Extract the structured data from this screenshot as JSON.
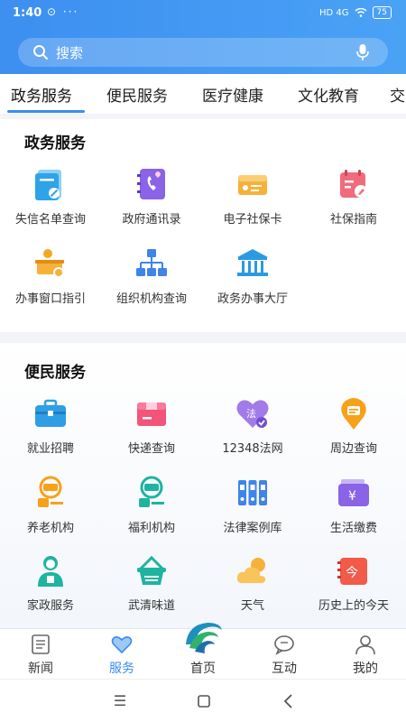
{
  "status": {
    "time": "1:40",
    "left_icons": "⊙ ···",
    "network": "HD 4G",
    "battery": "75"
  },
  "search": {
    "placeholder": "搜索"
  },
  "tabs": [
    "政务服务",
    "便民服务",
    "医疗健康",
    "文化教育",
    "交"
  ],
  "sections": [
    {
      "title": "政务服务",
      "items": [
        {
          "label": "失信名单查询",
          "icon": "document-list-icon"
        },
        {
          "label": "政府通讯录",
          "icon": "phone-book-icon"
        },
        {
          "label": "电子社保卡",
          "icon": "id-card-icon"
        },
        {
          "label": "社保指南",
          "icon": "calendar-edit-icon"
        },
        {
          "label": "办事窗口指引",
          "icon": "service-desk-icon"
        },
        {
          "label": "组织机构查询",
          "icon": "org-chart-icon"
        },
        {
          "label": "政务办事大厅",
          "icon": "government-hall-icon"
        }
      ]
    },
    {
      "title": "便民服务",
      "items": [
        {
          "label": "就业招聘",
          "icon": "briefcase-icon"
        },
        {
          "label": "快递查询",
          "icon": "package-icon"
        },
        {
          "label": "12348法网",
          "icon": "law-heart-icon"
        },
        {
          "label": "周边查询",
          "icon": "map-pin-icon"
        },
        {
          "label": "养老机构",
          "icon": "elderly-care-icon"
        },
        {
          "label": "福利机构",
          "icon": "welfare-icon"
        },
        {
          "label": "法律案例库",
          "icon": "binders-icon"
        },
        {
          "label": "生活缴费",
          "icon": "payment-icon"
        },
        {
          "label": "家政服务",
          "icon": "housekeeper-icon"
        },
        {
          "label": "武清味道",
          "icon": "food-basket-icon"
        },
        {
          "label": "天气",
          "icon": "weather-icon"
        },
        {
          "label": "历史上的今天",
          "icon": "today-calendar-icon"
        }
      ]
    }
  ],
  "bottom_nav": [
    {
      "label": "新闻",
      "icon": "news-icon"
    },
    {
      "label": "服务",
      "icon": "service-heart-icon",
      "active": true
    },
    {
      "label": "首页",
      "icon": "home-logo-icon"
    },
    {
      "label": "互动",
      "icon": "chat-icon"
    },
    {
      "label": "我的",
      "icon": "user-icon"
    }
  ],
  "colors": {
    "accent": "#3a8ef0",
    "header_start": "#3d8ff0",
    "header_end": "#4aa2f5"
  }
}
